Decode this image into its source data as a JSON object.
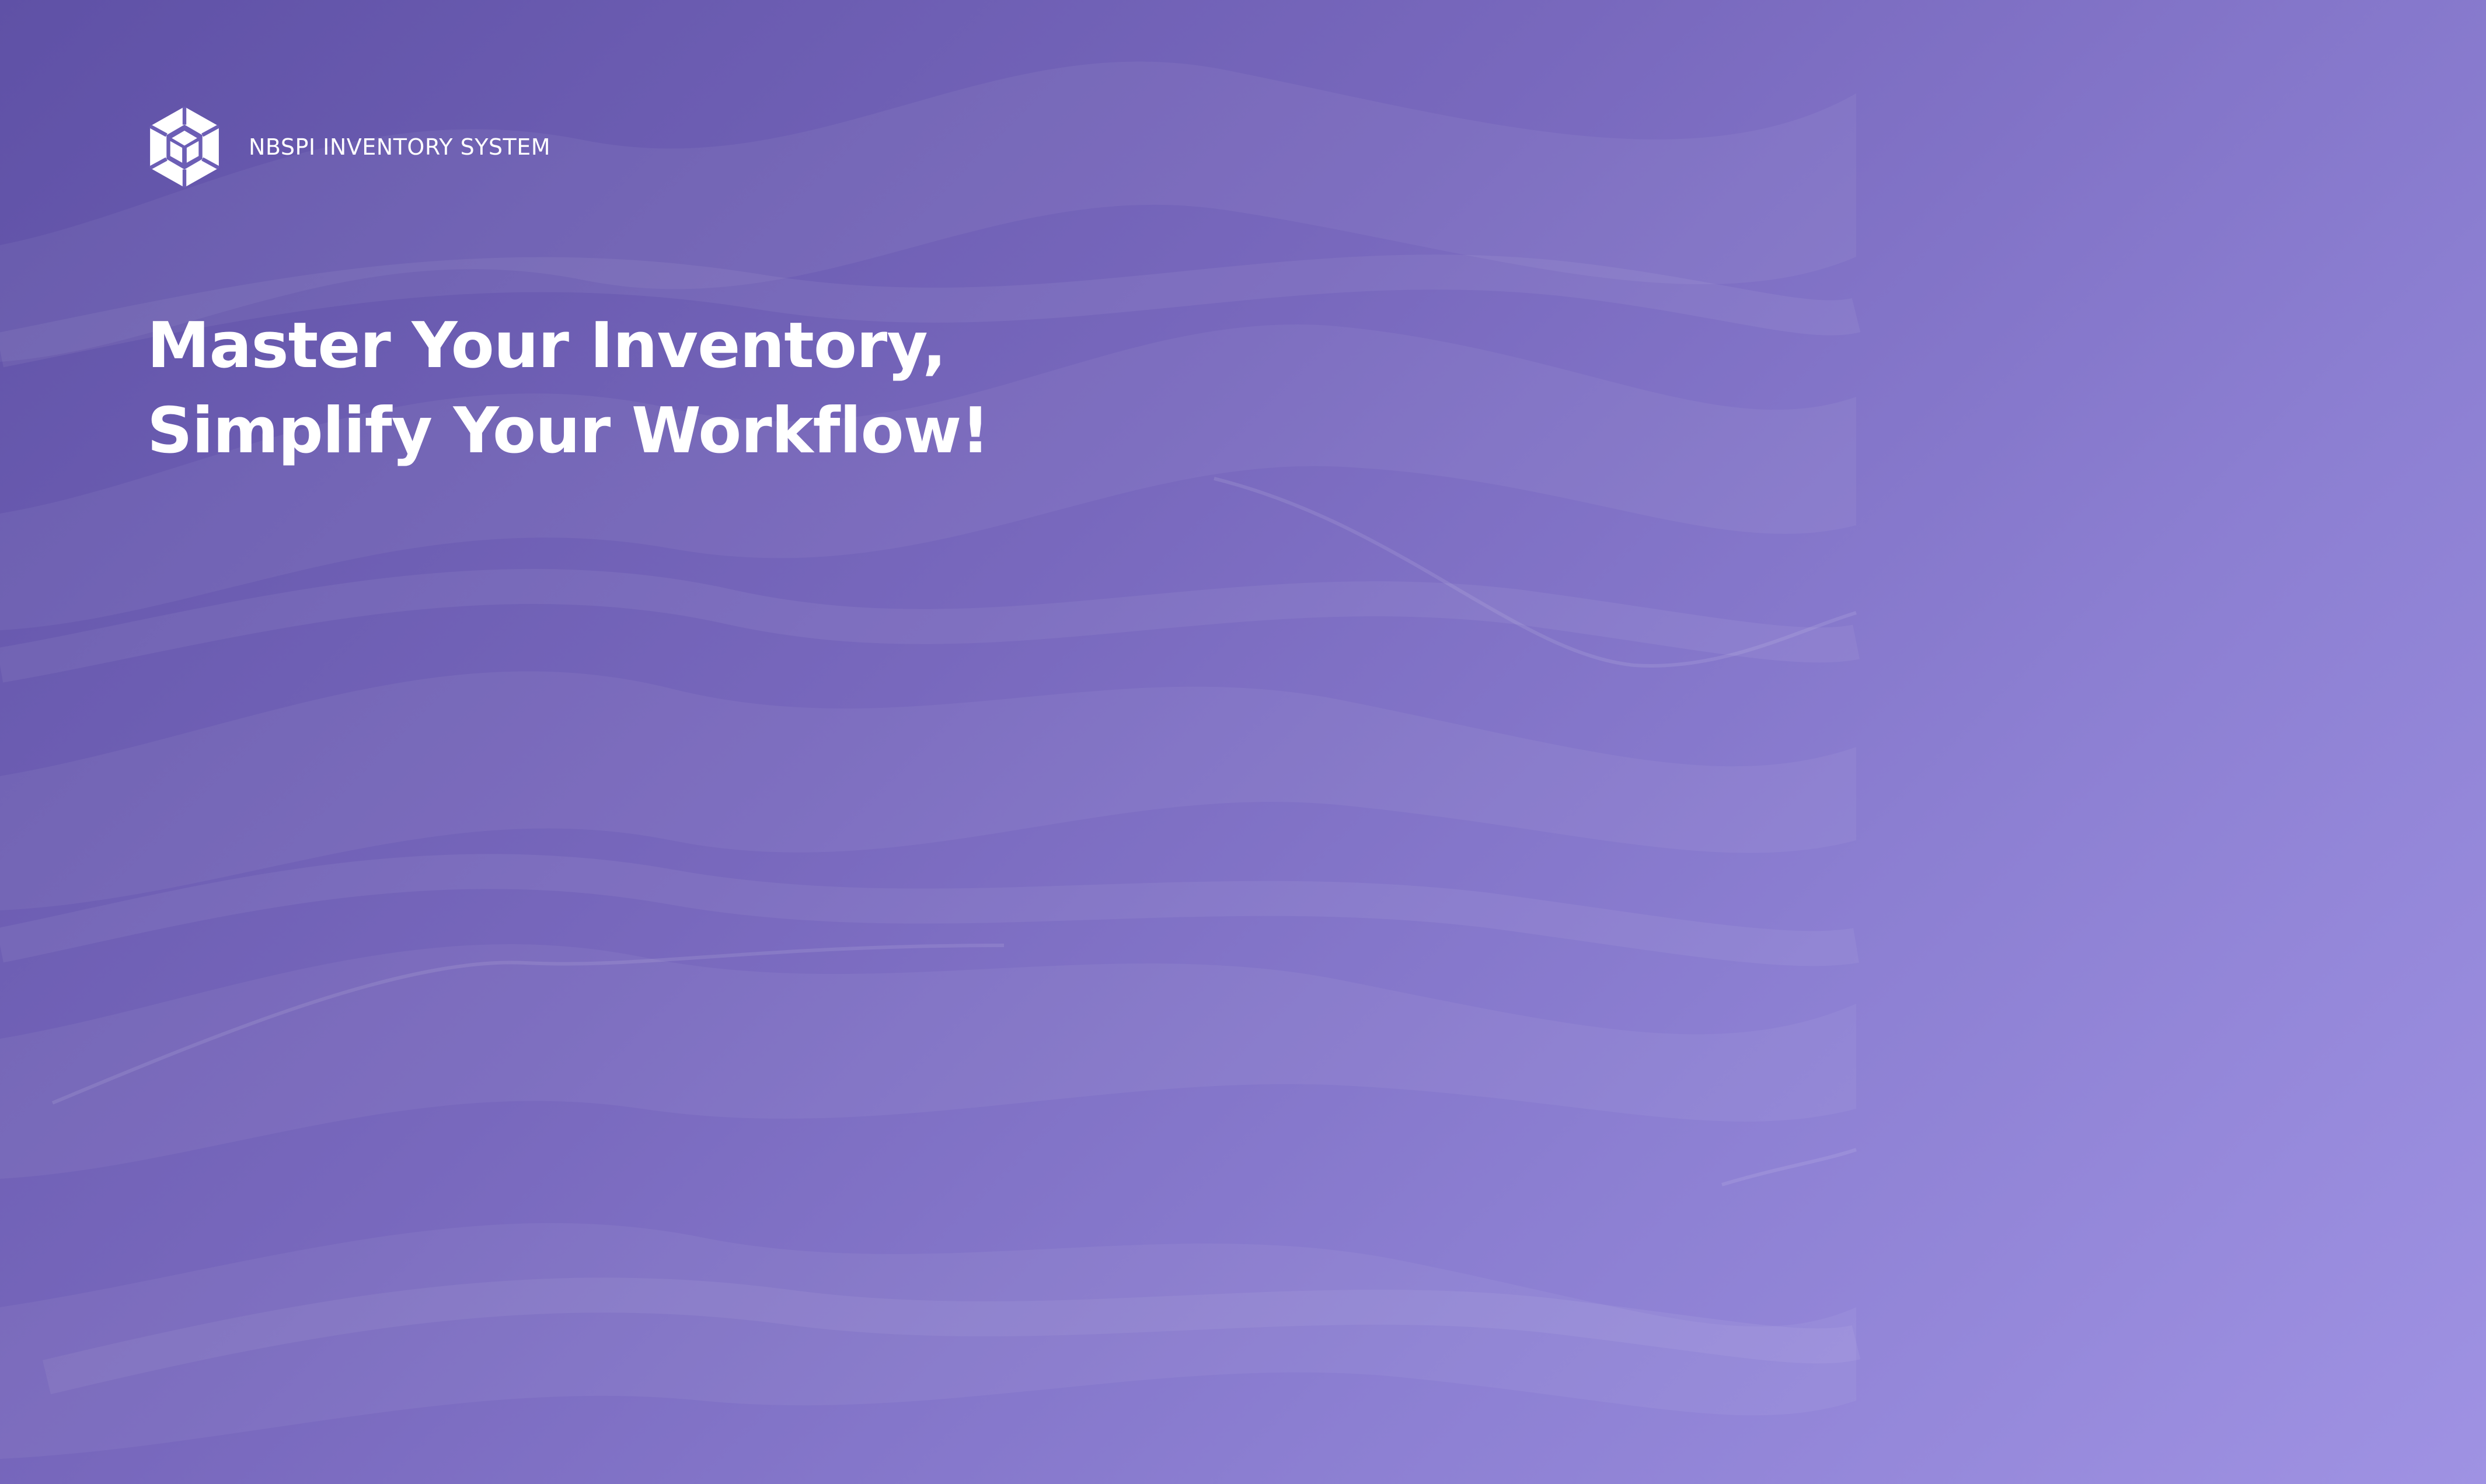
{
  "brand": {
    "logo_icon": "hexagon-cube-icon",
    "name": "NBSPI INVENTORY SYSTEM"
  },
  "hero": {
    "headline_line1": "Master Your Inventory,",
    "headline_line2": "Simplify Your Workflow!"
  },
  "colors": {
    "gradient_start": "#5f51a6",
    "gradient_end": "#9f92e3",
    "text": "#ffffff"
  }
}
